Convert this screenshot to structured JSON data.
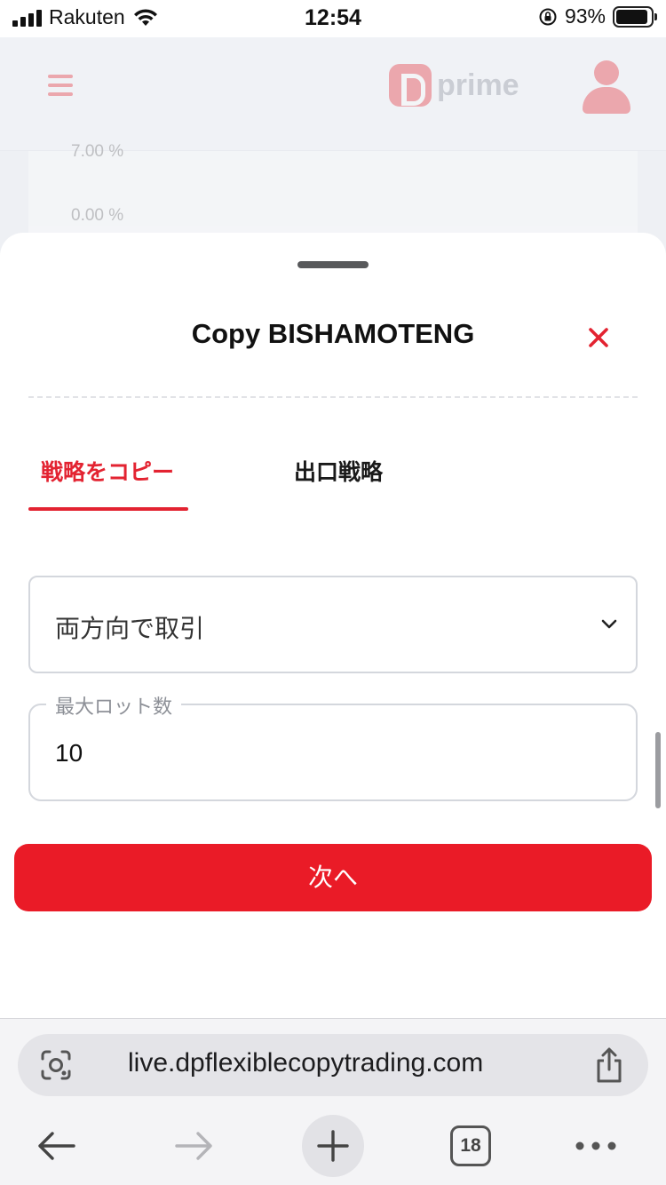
{
  "status_bar": {
    "carrier": "Rakuten",
    "time": "12:54",
    "battery": "93%",
    "battery_level": 0.93
  },
  "background": {
    "brand": "prime",
    "axis_labels": [
      "7.00 %",
      "0.00 %"
    ]
  },
  "sheet": {
    "title": "Copy BISHAMOTENG",
    "tabs": [
      {
        "label": "戦略をコピー",
        "active": true
      },
      {
        "label": "出口戦略",
        "active": false
      }
    ],
    "direction_select": {
      "value": "両方向で取引"
    },
    "max_lot": {
      "label": "最大ロット数",
      "value": "10"
    },
    "next_button": "次へ"
  },
  "browser": {
    "url": "live.dpflexiblecopytrading.com",
    "tab_count": "18"
  },
  "colors": {
    "accent": "#e32331",
    "button": "#ea1b27"
  }
}
